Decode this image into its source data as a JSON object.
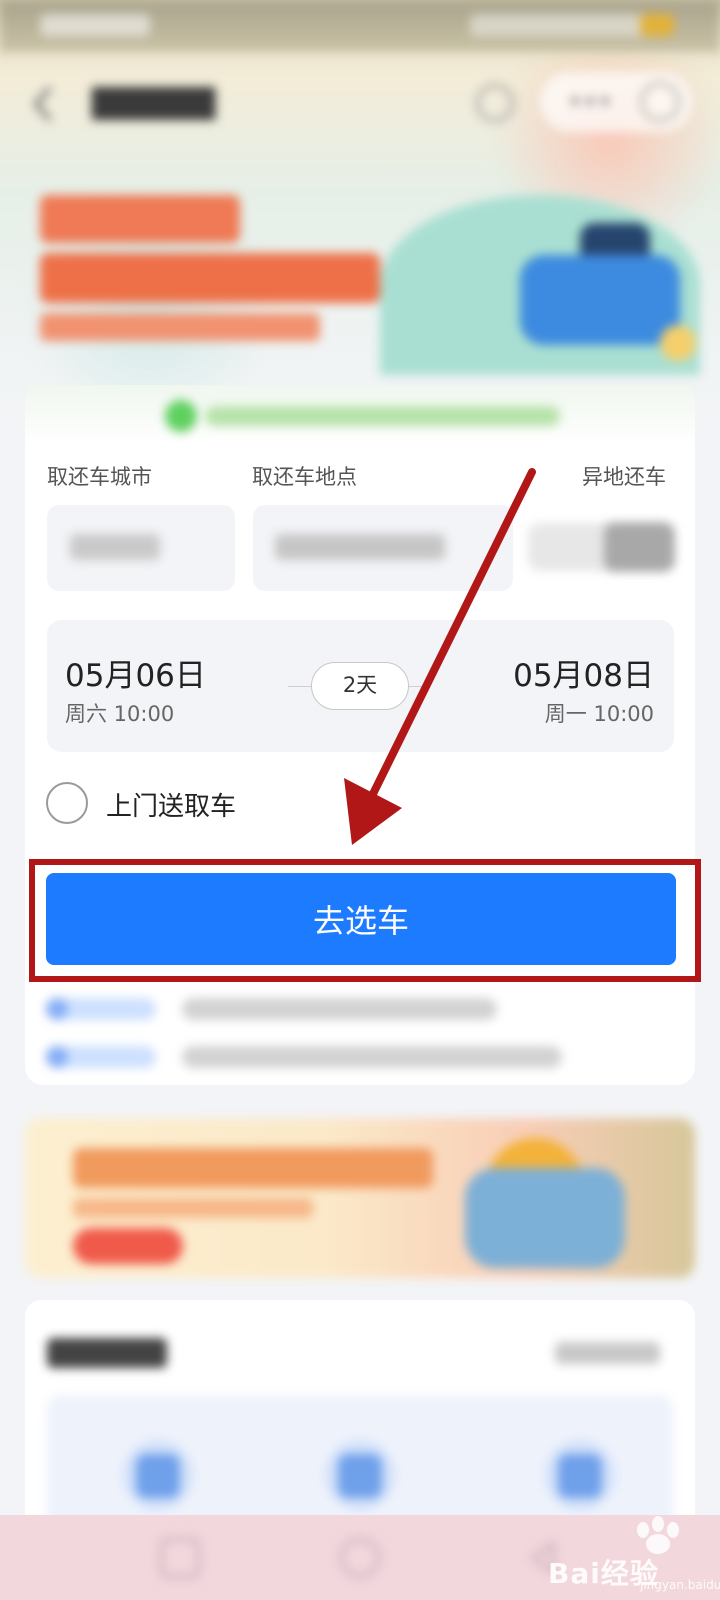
{
  "form": {
    "label_city": "取还车城市",
    "label_place": "取还车地点",
    "label_diff_return": "异地还车",
    "pickup": {
      "date": "05月06日",
      "time": "周六 10:00"
    },
    "return": {
      "date": "05月08日",
      "time": "周一 10:00"
    },
    "duration": "2天",
    "door_delivery_label": "上门送取车",
    "submit_label": "去选车"
  },
  "watermark": {
    "brand": "Bai经验",
    "site": "jingyan.baidu.com"
  },
  "colors": {
    "primary": "#1c7bff",
    "annotation": "#b21717"
  },
  "annotation": {
    "type": "arrow-and-box",
    "target": "submit-button"
  }
}
